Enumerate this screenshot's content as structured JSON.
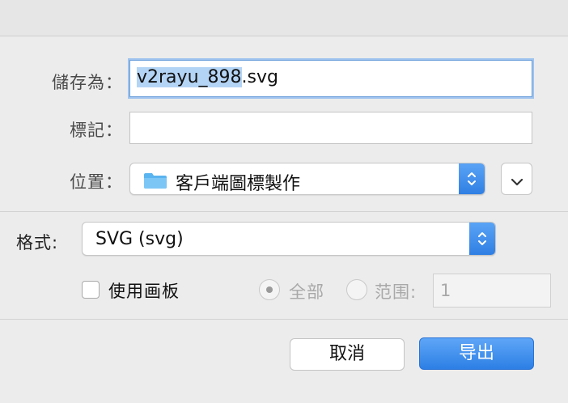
{
  "dialog": {
    "save_as_label": "儲存為：",
    "filename_selected": "v2rayu_898",
    "filename_ext": ".svg",
    "tags_label": "標記：",
    "tags_value": "",
    "location_label": "位置：",
    "location_value": "客戶端圖標製作",
    "format_label": "格式:",
    "format_value": "SVG (svg)",
    "use_artboards_label": "使用画板",
    "use_artboards_checked": false,
    "radio_all_label": "全部",
    "radio_range_label": "范围:",
    "range_value": "1",
    "cancel_label": "取消",
    "export_label": "导出"
  },
  "colors": {
    "accent": "#2f7fe3",
    "selection": "#b4d4f5",
    "folder": "#5ab4f0"
  }
}
